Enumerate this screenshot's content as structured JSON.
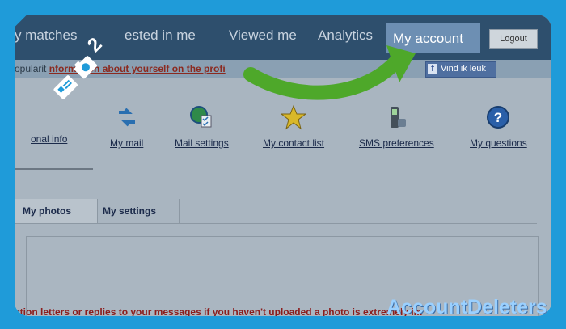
{
  "nav": {
    "items": [
      "y matches",
      "ested in me",
      "Viewed me",
      "Analytics"
    ],
    "active": "My account",
    "logout": "Logout"
  },
  "subbar": {
    "prefix": "opularit",
    "link": "nformation about yourself on the profi",
    "facebook_label": "Vind ik leuk",
    "facebook_icon": "facebook-icon"
  },
  "iconnav": [
    {
      "label": "onal info",
      "icon": "info-icon"
    },
    {
      "label": "My mail",
      "icon": "mail-icon"
    },
    {
      "label": "Mail settings",
      "icon": "settings-icon"
    },
    {
      "label": "My contact list",
      "icon": "star-icon"
    },
    {
      "label": "SMS preferences",
      "icon": "phone-icon"
    },
    {
      "label": "My questions",
      "icon": "question-icon"
    }
  ],
  "tabs": [
    "My photos",
    "My settings"
  ],
  "warning": "ction letters or replies to your messages if you haven't uploaded a photo is extremely im",
  "badge": {
    "step": "2",
    "icon": "camera-icon",
    "logo": "id-card-icon"
  },
  "watermark": "AccountDeleters"
}
